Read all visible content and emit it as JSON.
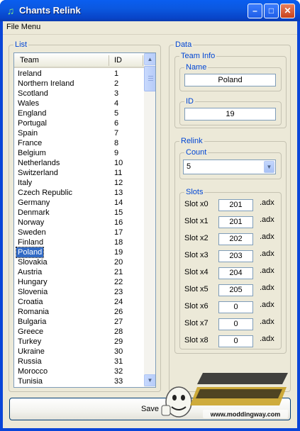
{
  "window": {
    "title": "Chants Relink",
    "icon": "music-note-icon"
  },
  "menu": {
    "file": "File Menu"
  },
  "list_group": {
    "label": "List"
  },
  "listview": {
    "columns": [
      "Team",
      "ID"
    ],
    "rows": [
      {
        "team": "Ireland",
        "id": "1"
      },
      {
        "team": "Northern Ireland",
        "id": "2"
      },
      {
        "team": "Scotland",
        "id": "3"
      },
      {
        "team": "Wales",
        "id": "4"
      },
      {
        "team": "England",
        "id": "5"
      },
      {
        "team": "Portugal",
        "id": "6"
      },
      {
        "team": "Spain",
        "id": "7"
      },
      {
        "team": "France",
        "id": "8"
      },
      {
        "team": "Belgium",
        "id": "9"
      },
      {
        "team": "Netherlands",
        "id": "10"
      },
      {
        "team": "Switzerland",
        "id": "11"
      },
      {
        "team": "Italy",
        "id": "12"
      },
      {
        "team": "Czech Republic",
        "id": "13"
      },
      {
        "team": "Germany",
        "id": "14"
      },
      {
        "team": "Denmark",
        "id": "15"
      },
      {
        "team": "Norway",
        "id": "16"
      },
      {
        "team": "Sweden",
        "id": "17"
      },
      {
        "team": "Finland",
        "id": "18"
      },
      {
        "team": "Poland",
        "id": "19",
        "selected": true
      },
      {
        "team": "Slovakia",
        "id": "20"
      },
      {
        "team": "Austria",
        "id": "21"
      },
      {
        "team": "Hungary",
        "id": "22"
      },
      {
        "team": "Slovenia",
        "id": "23"
      },
      {
        "team": "Croatia",
        "id": "24"
      },
      {
        "team": "Romania",
        "id": "26"
      },
      {
        "team": "Bulgaria",
        "id": "27"
      },
      {
        "team": "Greece",
        "id": "28"
      },
      {
        "team": "Turkey",
        "id": "29"
      },
      {
        "team": "Ukraine",
        "id": "30"
      },
      {
        "team": "Russia",
        "id": "31"
      },
      {
        "team": "Morocco",
        "id": "32"
      },
      {
        "team": "Tunisia",
        "id": "33"
      }
    ]
  },
  "data_group": {
    "label": "Data",
    "team_info": {
      "label": "Team Info",
      "name_label": "Name",
      "name_value": "Poland",
      "id_label": "ID",
      "id_value": "19"
    },
    "relink": {
      "label": "Relink",
      "count_label": "Count",
      "count_value": "5",
      "slots_label": "Slots",
      "slots": [
        {
          "label": "Slot x0",
          "value": "201",
          "ext": ".adx"
        },
        {
          "label": "Slot x1",
          "value": "201",
          "ext": ".adx"
        },
        {
          "label": "Slot x2",
          "value": "202",
          "ext": ".adx"
        },
        {
          "label": "Slot x3",
          "value": "203",
          "ext": ".adx"
        },
        {
          "label": "Slot x4",
          "value": "204",
          "ext": ".adx"
        },
        {
          "label": "Slot x5",
          "value": "205",
          "ext": ".adx"
        },
        {
          "label": "Slot x6",
          "value": "0",
          "ext": ".adx"
        },
        {
          "label": "Slot x7",
          "value": "0",
          "ext": ".adx"
        },
        {
          "label": "Slot x8",
          "value": "0",
          "ext": ".adx"
        }
      ]
    }
  },
  "save_button": {
    "label": "Save"
  },
  "watermark": {
    "logo": "MODDING WAY",
    "url": "www.moddingway.com"
  },
  "colors": {
    "titlebar": "#0a5ef0",
    "selection": "#316ac5",
    "group_label": "#0046d5",
    "face": "#ece9d8"
  }
}
